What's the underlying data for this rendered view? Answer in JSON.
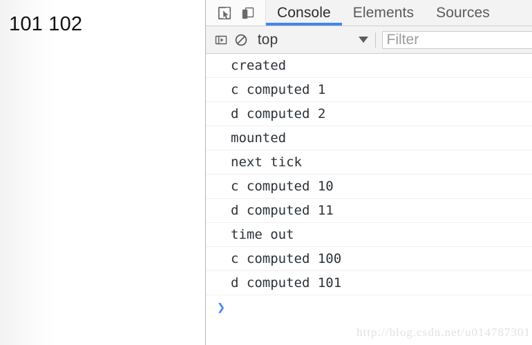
{
  "page": {
    "output_text": "101 102"
  },
  "devtools": {
    "tool_icons": [
      {
        "name": "inspect-element-icon",
        "label": "Inspect element"
      },
      {
        "name": "device-toolbar-icon",
        "label": "Toggle device toolbar"
      }
    ],
    "tabs": [
      {
        "label": "Console",
        "active": true
      },
      {
        "label": "Elements",
        "active": false
      },
      {
        "label": "Sources",
        "active": false
      }
    ],
    "active_tab": "Console",
    "accent_color": "#4285f4",
    "toolbar": {
      "sidebar_toggle_icon": "console-sidebar-icon",
      "clear_console_icon": "clear-console-icon",
      "context_value": "top",
      "context_caret_icon": "chevron-down-icon",
      "filter_value": "",
      "filter_placeholder": "Filter"
    },
    "console": {
      "messages": [
        "created",
        "c computed 1",
        "d computed 2",
        "mounted",
        "next tick",
        "c computed 10",
        "d computed 11",
        "time out",
        "c computed 100",
        "d computed 101"
      ],
      "prompt_symbol": "❯",
      "prompt_value": ""
    }
  },
  "watermark": {
    "text": "http://blog.csdn.net/u014787301"
  }
}
